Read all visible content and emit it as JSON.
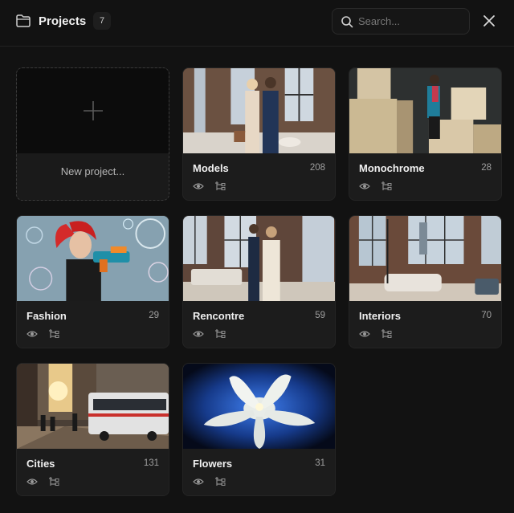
{
  "header": {
    "title": "Projects",
    "count": "7",
    "search_placeholder": "Search...",
    "icons": {
      "folder": "folder-icon",
      "search": "search-icon",
      "close": "close-icon"
    }
  },
  "new_project": {
    "label": "New project...",
    "icon": "plus-icon"
  },
  "projects": [
    {
      "name": "Models",
      "count": "208"
    },
    {
      "name": "Monochrome",
      "count": "28"
    },
    {
      "name": "Fashion",
      "count": "29"
    },
    {
      "name": "Rencontre",
      "count": "59"
    },
    {
      "name": "Interiors",
      "count": "70"
    },
    {
      "name": "Cities",
      "count": "131"
    },
    {
      "name": "Flowers",
      "count": "31"
    }
  ],
  "colors": {
    "background": "#121212",
    "card": "#1c1c1c",
    "text": "#f0f0f0",
    "muted": "#a0a0a0"
  }
}
